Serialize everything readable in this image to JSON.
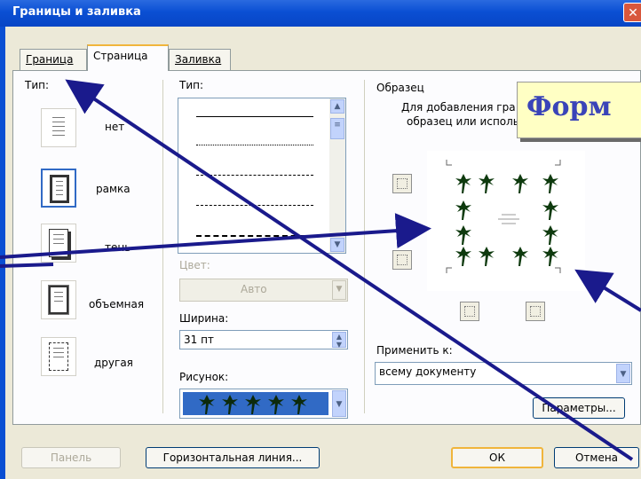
{
  "window": {
    "title": "Границы и заливка",
    "close_glyph": "✕"
  },
  "tabs": [
    {
      "label": "Граница"
    },
    {
      "label": "Страница"
    },
    {
      "label": "Заливка"
    }
  ],
  "setting": {
    "label": "Тип:",
    "options": [
      {
        "label": "нет"
      },
      {
        "label": "рамка"
      },
      {
        "label": "тень"
      },
      {
        "label": "объемная"
      },
      {
        "label": "другая"
      }
    ]
  },
  "style": {
    "label": "Тип:",
    "color_label": "Цвет:",
    "color_value": "Авто",
    "width_label": "Ширина:",
    "width_value": "31 пт",
    "art_label": "Рисунок:"
  },
  "preview": {
    "label": "Образец",
    "hint_line1": "Для добавления гра",
    "hint_line2": "образец или исполь",
    "apply_label": "Применить к:",
    "apply_value": "всему документу",
    "options_button": "Параметры..."
  },
  "footer": {
    "panel_button": "Панель",
    "hline_button": "Горизонтальная линия...",
    "ok_button": "ОК",
    "cancel_button": "Отмена"
  },
  "callout": {
    "text": "Форм"
  },
  "colors": {
    "arrow": "#1a1a8c",
    "titlebar": "#0a4fd3",
    "callout_text": "#3a44b8"
  },
  "icons": [
    "close-icon",
    "palm-tree-icon",
    "scroll-up-icon",
    "scroll-down-icon",
    "dropdown-arrow-icon",
    "spin-icon"
  ]
}
